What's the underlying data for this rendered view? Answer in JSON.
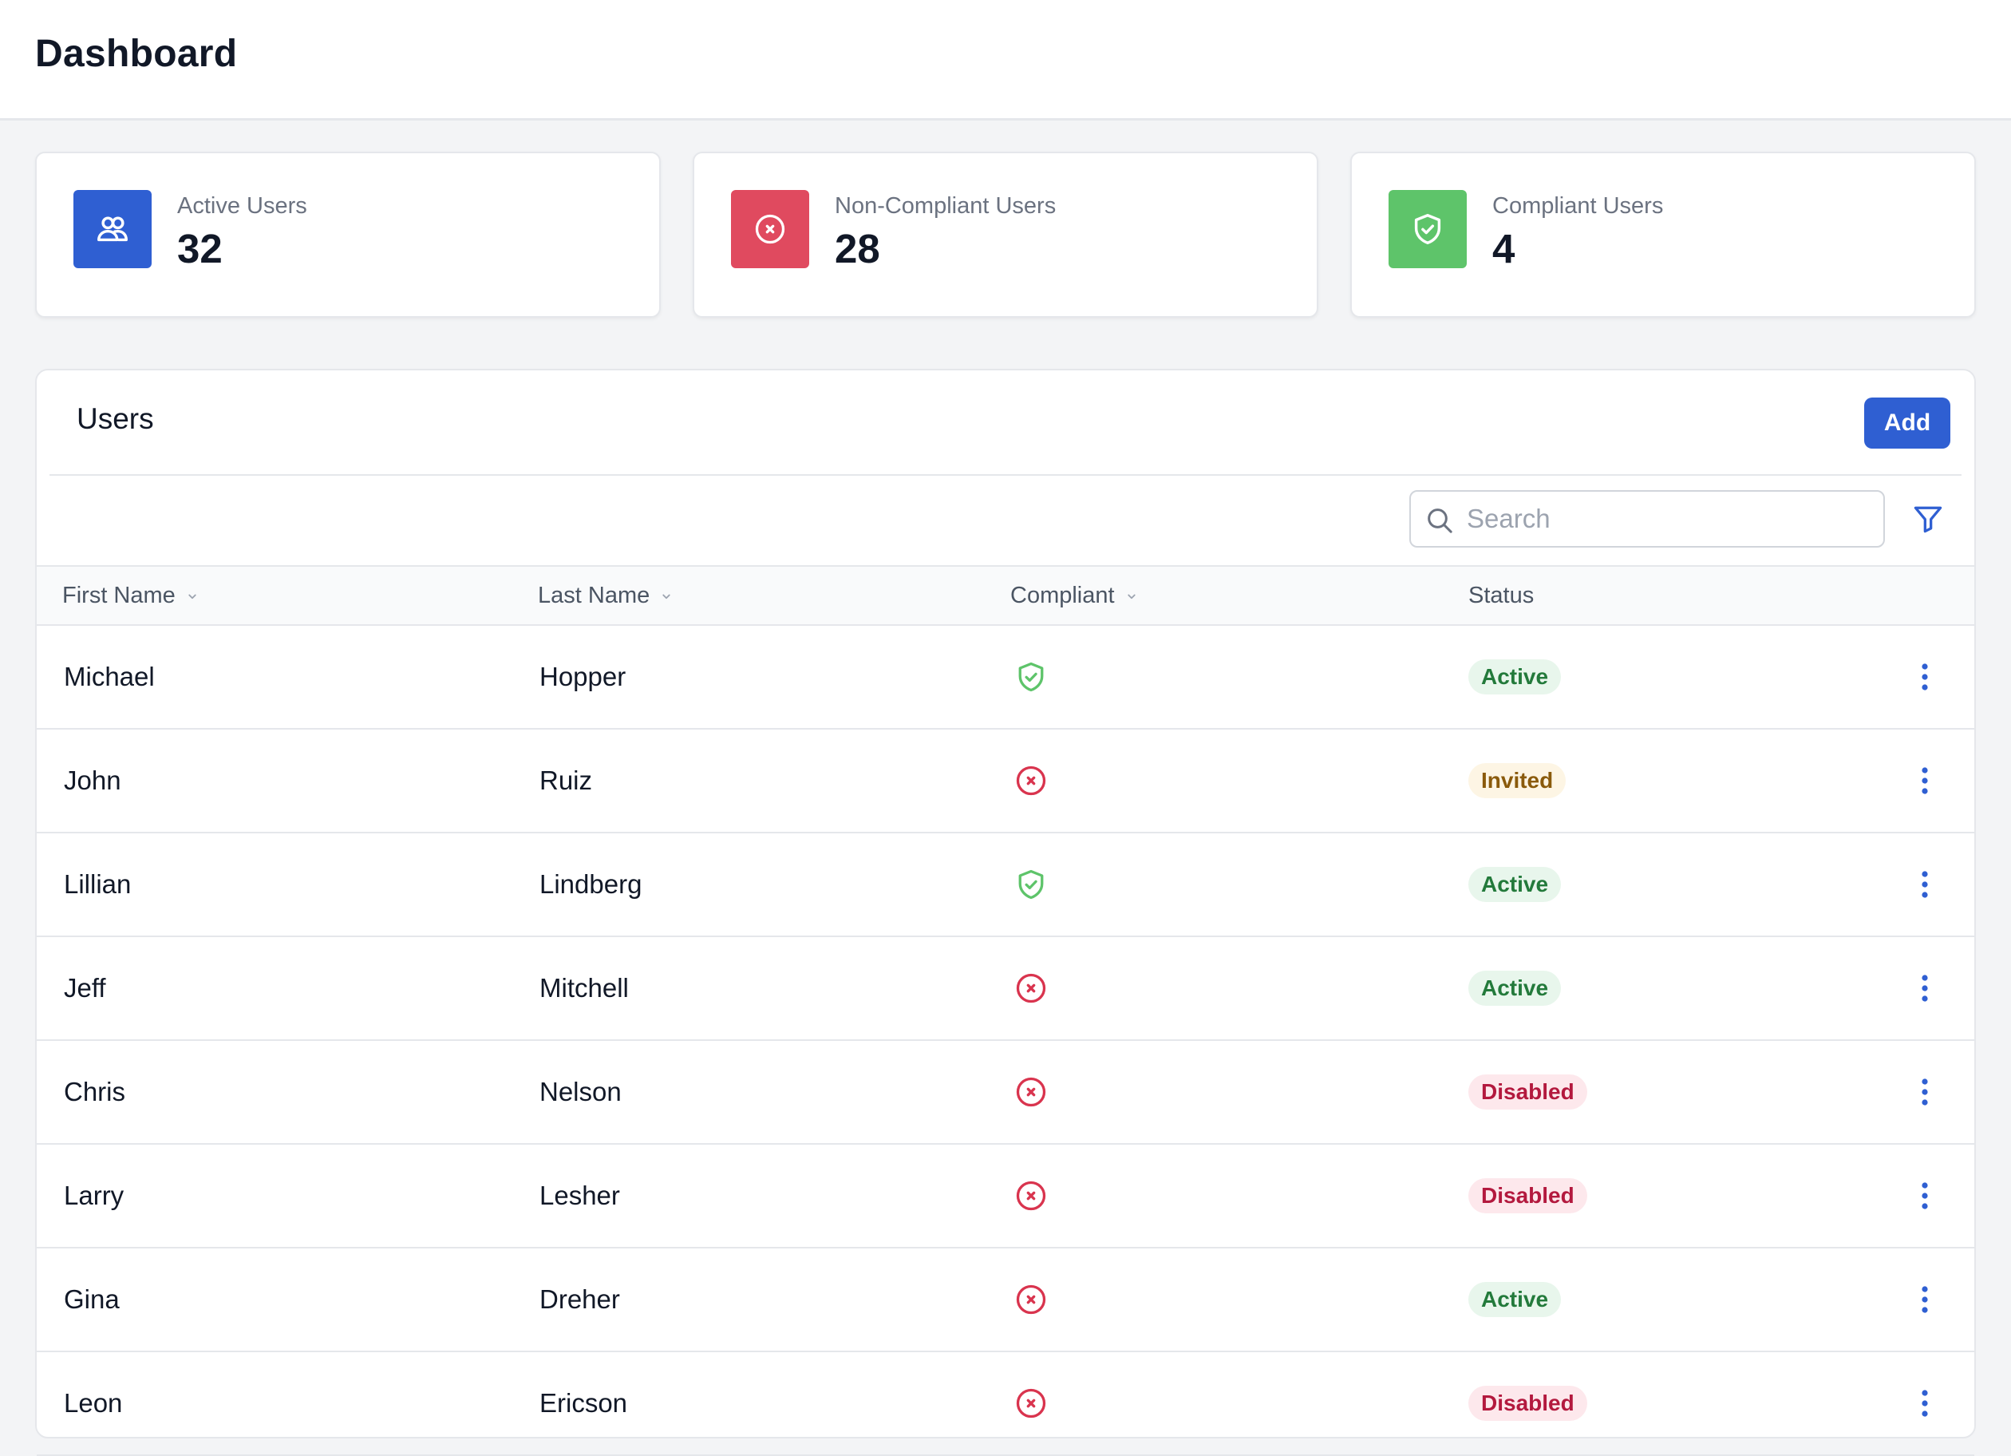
{
  "page": {
    "title": "Dashboard"
  },
  "stats": [
    {
      "label": "Active Users",
      "value": "32",
      "icon": "users-icon",
      "color": "#2f5fd2"
    },
    {
      "label": "Non-Compliant Users",
      "value": "28",
      "icon": "x-circle-icon",
      "color": "#e04a5f"
    },
    {
      "label": "Compliant Users",
      "value": "4",
      "icon": "shield-check-icon",
      "color": "#5ec46a"
    }
  ],
  "users_panel": {
    "title": "Users",
    "add_label": "Add",
    "search": {
      "placeholder": "Search",
      "value": ""
    },
    "columns": [
      "First Name",
      "Last Name",
      "Compliant",
      "Status"
    ],
    "rows": [
      {
        "first": "Michael",
        "last": "Hopper",
        "compliant": true,
        "status": "Active"
      },
      {
        "first": "John",
        "last": "Ruiz",
        "compliant": false,
        "status": "Invited"
      },
      {
        "first": "Lillian",
        "last": "Lindberg",
        "compliant": true,
        "status": "Active"
      },
      {
        "first": "Jeff",
        "last": "Mitchell",
        "compliant": false,
        "status": "Active"
      },
      {
        "first": "Chris",
        "last": "Nelson",
        "compliant": false,
        "status": "Disabled"
      },
      {
        "first": "Larry",
        "last": "Lesher",
        "compliant": false,
        "status": "Disabled"
      },
      {
        "first": "Gina",
        "last": "Dreher",
        "compliant": false,
        "status": "Active"
      },
      {
        "first": "Leon",
        "last": "Ericson",
        "compliant": false,
        "status": "Disabled"
      }
    ]
  },
  "colors": {
    "primary": "#2f5fd2",
    "compliant": "#5ec46a",
    "noncompliant": "#d9344e"
  }
}
